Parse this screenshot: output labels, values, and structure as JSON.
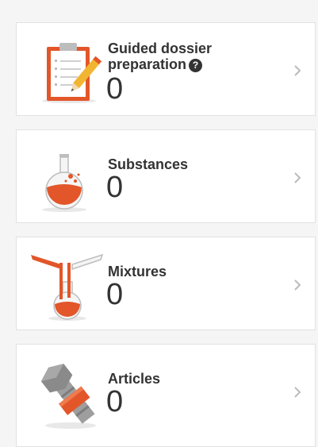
{
  "cards": [
    {
      "title_line1": "Guided dossier",
      "title_line2": "preparation",
      "count": "0",
      "help_glyph": "?"
    },
    {
      "title": "Substances",
      "count": "0"
    },
    {
      "title": "Mixtures",
      "count": "0"
    },
    {
      "title": "Articles",
      "count": "0"
    }
  ],
  "icons": {
    "card1": "clipboard-pencil-icon",
    "card2": "flask-icon",
    "card3": "mixing-flasks-icon",
    "card4": "bolt-nut-icon",
    "chevron": "chevron-right-icon",
    "help": "help-icon"
  },
  "colors": {
    "accent": "#e2562a",
    "text": "#333333",
    "border": "#e2e2e2",
    "background": "#f5f5f5",
    "chevron": "#bbbbbb"
  }
}
